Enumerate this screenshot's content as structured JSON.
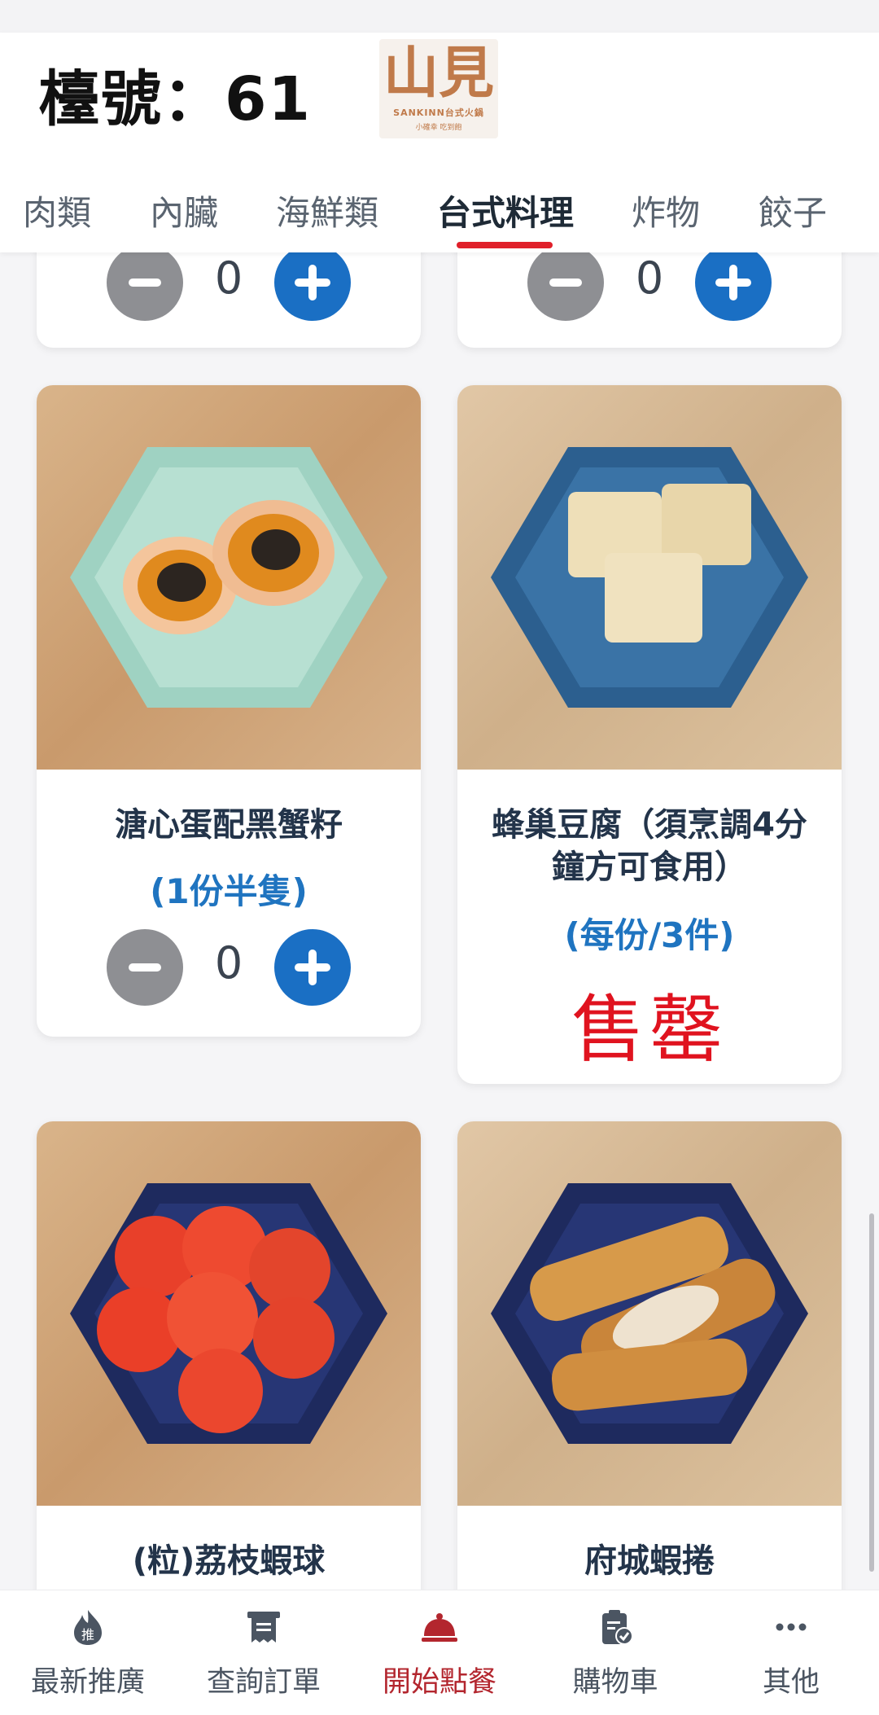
{
  "header": {
    "table_label": "檯號：61",
    "logo": {
      "mark": "山見",
      "brand": "SANKINN台式火鍋",
      "slogan": "小確幸 吃到飽"
    }
  },
  "tabs": [
    {
      "label": "肉類"
    },
    {
      "label": "內臟"
    },
    {
      "label": "海鮮類"
    },
    {
      "label": "台式料理",
      "active": true
    },
    {
      "label": "炸物"
    },
    {
      "label": "餃子"
    }
  ],
  "items": [
    {
      "title": "",
      "quantity": "0"
    },
    {
      "title": "",
      "quantity": "0"
    },
    {
      "title": "溏心蛋配黑蟹籽",
      "subtitle": "(1份半隻)",
      "quantity": "0"
    },
    {
      "title_line1": "蜂巢豆腐（須烹調4分",
      "title_line2": "鐘方可食用）",
      "subtitle": "(每份/3件)",
      "status": "售罄"
    },
    {
      "title": "(粒)荔枝蝦球"
    },
    {
      "title": "府城蝦捲"
    }
  ],
  "bottom_nav": [
    {
      "label": "最新推廣",
      "icon": "flame-icon"
    },
    {
      "label": "查詢訂單",
      "icon": "receipt-icon"
    },
    {
      "label": "開始點餐",
      "icon": "cloche-icon",
      "active": true
    },
    {
      "label": "購物車",
      "icon": "clipboard-check-icon"
    },
    {
      "label": "其他",
      "icon": "more-icon"
    }
  ],
  "colors": {
    "accent_red": "#e0202a",
    "plus_blue": "#1a6fc4",
    "minus_gray": "#8e8f93",
    "subtitle_blue": "#1f74c0",
    "soldout_red": "#e0131f",
    "active_nav": "#b3262e"
  }
}
